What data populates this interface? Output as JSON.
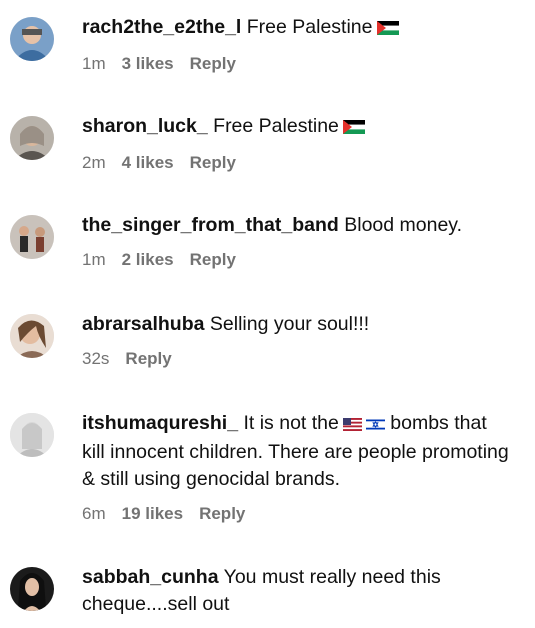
{
  "comments": [
    {
      "username": "rach2the_e2the_l",
      "text": "Free Palestine",
      "flag": "palestine",
      "time": "1m",
      "likes": "3 likes",
      "reply": "Reply"
    },
    {
      "username": "sharon_luck_",
      "text": "Free Palestine",
      "flag": "palestine",
      "time": "2m",
      "likes": "4 likes",
      "reply": "Reply"
    },
    {
      "username": "the_singer_from_that_band",
      "text": "Blood money.",
      "time": "1m",
      "likes": "2 likes",
      "reply": "Reply"
    },
    {
      "username": "abrarsalhuba",
      "text": "Selling your soul!!!",
      "time": "32s",
      "reply": "Reply"
    },
    {
      "username": "itshumaqureshi_",
      "text_before": "It is not the",
      "text_after": "bombs that kill innocent children. There are people promoting & still using genocidal brands.",
      "time": "6m",
      "likes": "19 likes",
      "reply": "Reply"
    },
    {
      "username": "sabbah_cunha",
      "text": "You must really need this cheque....sell out"
    }
  ],
  "colors": {
    "meta": "#737373",
    "text": "#111111",
    "background": "#ffffff"
  }
}
